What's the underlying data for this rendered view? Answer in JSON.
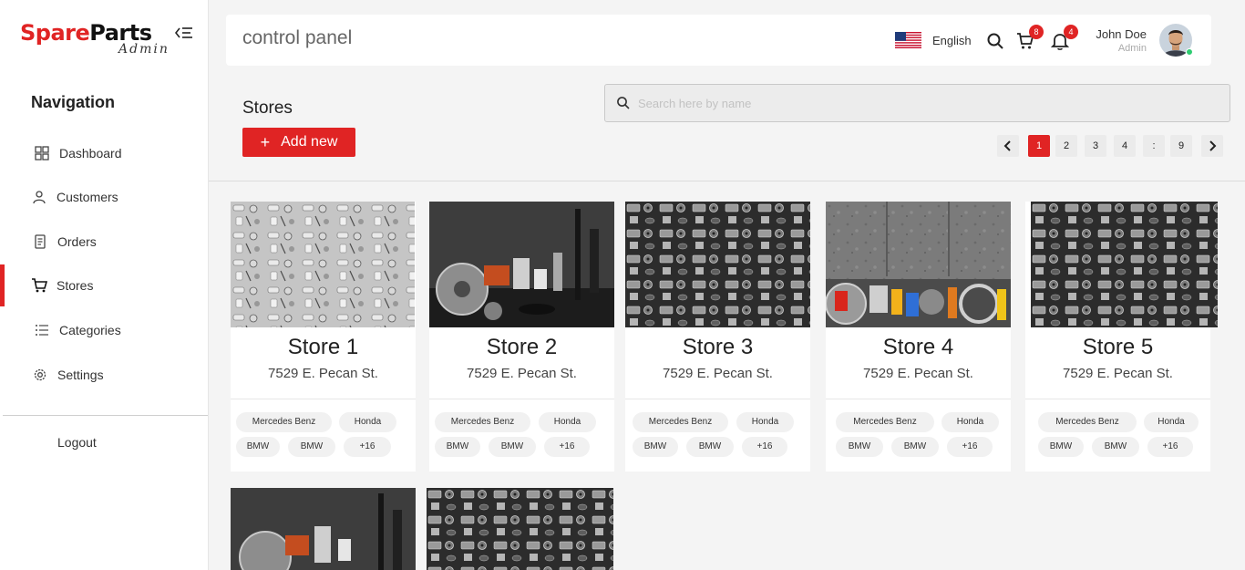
{
  "brand": {
    "name_part1": "Spare",
    "name_part2": "Parts",
    "subtitle": "Admin"
  },
  "sidebar": {
    "title": "Navigation",
    "items": [
      {
        "label": "Dashboard",
        "icon": "grid-icon",
        "active": false
      },
      {
        "label": "Customers",
        "icon": "user-icon",
        "active": false
      },
      {
        "label": "Orders",
        "icon": "document-icon",
        "active": false
      },
      {
        "label": "Stores",
        "icon": "cart-icon",
        "active": true
      },
      {
        "label": "Categories",
        "icon": "list-icon",
        "active": false
      },
      {
        "label": "Settings",
        "icon": "gear-icon",
        "active": false
      }
    ],
    "logout_label": "Logout"
  },
  "header": {
    "title": "control panel",
    "language": "English",
    "cart_count": "8",
    "notification_count": "4",
    "user_name": "John Doe",
    "user_role": "Admin"
  },
  "page": {
    "title": "Stores",
    "add_button_label": "Add new",
    "search_placeholder": "Search here by name"
  },
  "pagination": {
    "pages": [
      "1",
      "2",
      "3",
      "4",
      ":",
      "9"
    ],
    "current": "1"
  },
  "stores": [
    {
      "name": "Store 1",
      "address": "7529 E. Pecan St.",
      "tags": [
        "Mercedes Benz",
        "Honda",
        "BMW",
        "BMW",
        "+16"
      ]
    },
    {
      "name": "Store 2",
      "address": "7529 E. Pecan St.",
      "tags": [
        "Mercedes Benz",
        "Honda",
        "BMW",
        "BMW",
        "+16"
      ]
    },
    {
      "name": "Store 3",
      "address": "7529 E. Pecan St.",
      "tags": [
        "Mercedes Benz",
        "Honda",
        "BMW",
        "BMW",
        "+16"
      ]
    },
    {
      "name": "Store 4",
      "address": "7529 E. Pecan St.",
      "tags": [
        "Mercedes Benz",
        "Honda",
        "BMW",
        "BMW",
        "+16"
      ]
    },
    {
      "name": "Store 5",
      "address": "7529 E. Pecan St.",
      "tags": [
        "Mercedes Benz",
        "Honda",
        "BMW",
        "BMW",
        "+16"
      ]
    }
  ],
  "colors": {
    "accent": "#e02424",
    "background": "#f4f4f4",
    "card": "#ffffff",
    "online": "#2ecc71"
  }
}
